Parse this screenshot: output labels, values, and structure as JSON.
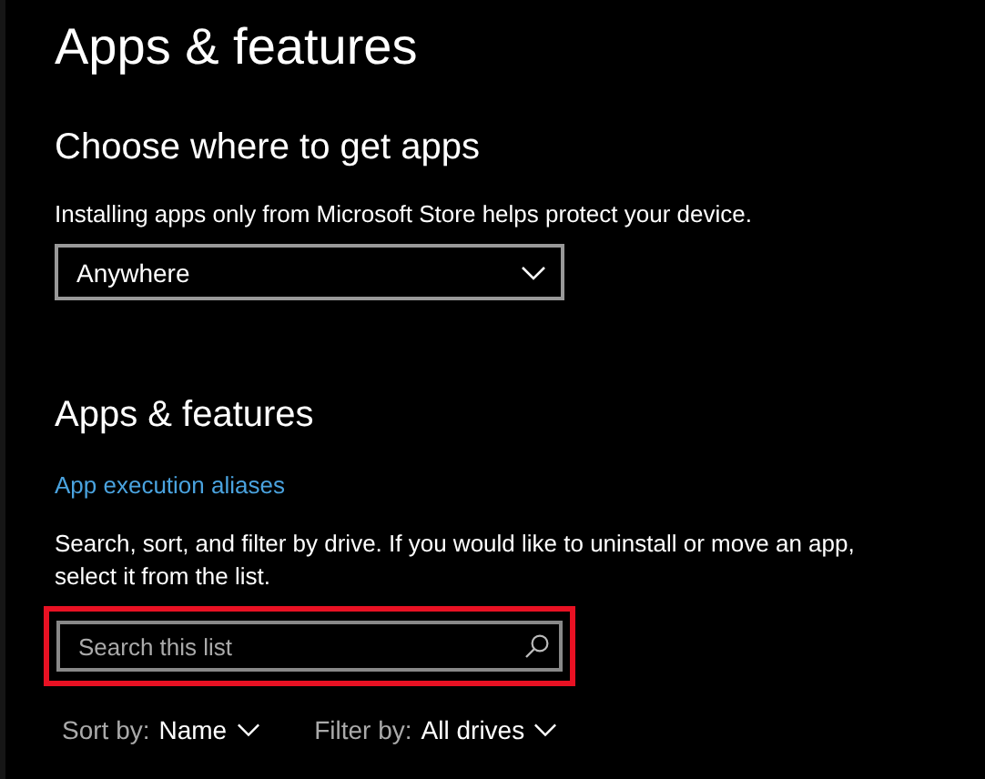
{
  "page_title": "Apps & features",
  "source_section": {
    "heading": "Choose where to get apps",
    "description": "Installing apps only from Microsoft Store helps protect your device.",
    "dropdown": {
      "value": "Anywhere"
    }
  },
  "apps_section": {
    "heading": "Apps & features",
    "link": "App execution aliases",
    "description": "Search, sort, and filter by drive. If you would like to uninstall or move an app, select it from the list.",
    "search": {
      "placeholder": "Search this list",
      "highlighted": true
    },
    "sort": {
      "label": "Sort by:",
      "value": "Name"
    },
    "filter": {
      "label": "Filter by:",
      "value": "All drives"
    }
  }
}
